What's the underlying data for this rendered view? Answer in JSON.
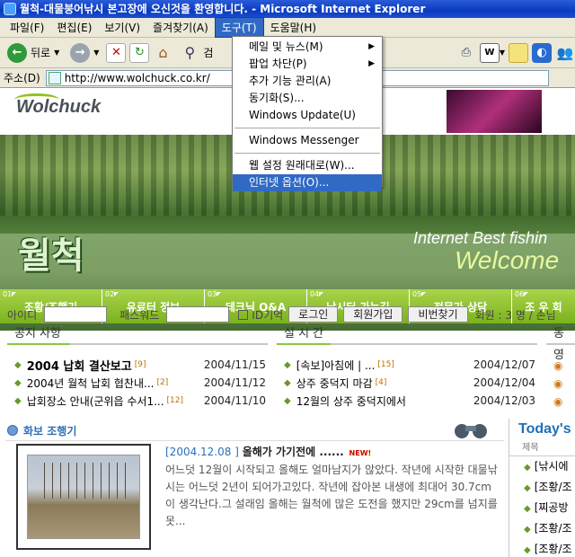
{
  "window": {
    "title": "월척-대물붕어낚시 본고장에 오신것을 환영합니다. - Microsoft Internet Explorer"
  },
  "menu": {
    "items": [
      "파일(F)",
      "편집(E)",
      "보기(V)",
      "즐겨찾기(A)",
      "도구(T)",
      "도움말(H)"
    ],
    "active_index": 4
  },
  "toolbar": {
    "back_label": "뒤로",
    "search_label": "검"
  },
  "address": {
    "label": "주소(D)",
    "url": "http://www.wolchuck.co.kr/"
  },
  "tools_menu": {
    "items": [
      {
        "label": "메일 및 뉴스(M)",
        "submenu": true
      },
      {
        "label": "팝업 차단(P)",
        "submenu": true
      },
      {
        "label": "추가 기능 관리(A)"
      },
      {
        "label": "동기화(S)..."
      },
      {
        "label": "Windows Update(U)"
      },
      {
        "label": "Windows Messenger"
      },
      {
        "label": "웹 설정 원래대로(W)..."
      },
      {
        "label": "인터넷 옵션(O)...",
        "selected": true
      }
    ]
  },
  "site": {
    "logo": "Wolchuck",
    "banner_name": "월척",
    "banner_sub": "Internet Best fishin",
    "banner_welcome": "Welcome",
    "nav": [
      {
        "num": "01",
        "label": "조황/조행기"
      },
      {
        "num": "02",
        "label": "유료터 정보"
      },
      {
        "num": "03",
        "label": "테크닉 Q&A"
      },
      {
        "num": "04",
        "label": "낚시터 가는길"
      },
      {
        "num": "05",
        "label": "전문가 상담"
      },
      {
        "num": "06",
        "label": "조 우 회"
      }
    ],
    "login": {
      "id_label": "아이디",
      "pw_label": "패스워드",
      "remember_label": "ID기억",
      "login_btn": "로그인",
      "join_btn": "회원가입",
      "find_btn": "비번찾기",
      "members": "회원 : 3 명 / 손님"
    },
    "notice": {
      "title": "공지 사항",
      "items": [
        {
          "text": "2004 납회 결산보고",
          "count": "[9]",
          "date": "2004/11/15",
          "bold": true
        },
        {
          "text": "2004년 월척 납회 협찬내...",
          "count": "[2]",
          "date": "2004/11/12"
        },
        {
          "text": "납회장소 안내(군위읍 수서1...",
          "count": "[12]",
          "date": "2004/11/10"
        }
      ]
    },
    "realtime": {
      "title": "실 시 간",
      "items": [
        {
          "text": "[속보]아침에 | ...",
          "count": "[15]",
          "date": "2004/12/07"
        },
        {
          "text": "상주 중덕지 마감",
          "count": "[4]",
          "date": "2004/12/04"
        },
        {
          "text": "12월의 상주 중덕지에서",
          "count": "",
          "date": "2004/12/03"
        }
      ]
    },
    "third": {
      "title": "동 영"
    },
    "photo": {
      "head": "화보 조행기",
      "date": "[2004.12.08 ]",
      "title": "올해가 가기전에 ......",
      "new_badge": "NEW!",
      "desc": "어느덧 12월이 시작되고 올해도 얼마남지가 않았다. 작년에 시작한 대물낚시는 어느덧 2년이 되어가고있다. 작년에 잡아본 내생에 최대어 30.7cm이 생각난다.그 설래임 올해는 월척에 많은 도전을 했지만 29cm를 넘지를 못..."
    },
    "today": {
      "title": "Today's",
      "subtitle": "제목",
      "items": [
        "[낚시에",
        "[조황/조",
        "[찌공방",
        "[조황/조",
        "[조황/조"
      ]
    }
  }
}
